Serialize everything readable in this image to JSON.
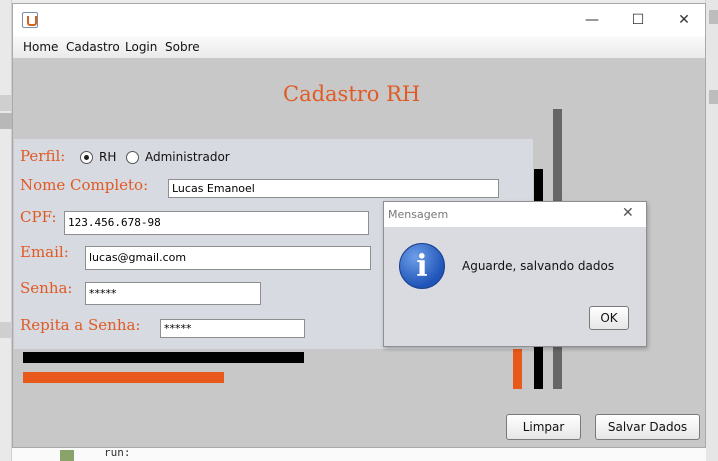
{
  "window": {
    "title": ""
  },
  "menu": {
    "items": [
      "Home",
      "Cadastro",
      "Login",
      "Sobre"
    ]
  },
  "form": {
    "heading": "Cadastro RH",
    "perfil_label": "Perfil:",
    "perfil_options": [
      {
        "label": "RH",
        "selected": true
      },
      {
        "label": "Administrador",
        "selected": false
      }
    ],
    "nome_label": "Nome Completo:",
    "nome_value": "Lucas Emanoel",
    "cpf_label": "CPF:",
    "cpf_value": "123.456.678-98",
    "email_label": "Email:",
    "email_value": "lucas@gmail.com",
    "senha_label": "Senha:",
    "senha_value": "*****",
    "repita_label": "Repita a Senha:",
    "repita_value": "*****"
  },
  "buttons": {
    "limpar": "Limpar",
    "salvar": "Salvar Dados"
  },
  "dialog": {
    "title": "Mensagem",
    "message": "Aguarde, salvando dados",
    "ok": "OK",
    "icon": "info-icon"
  },
  "background_code": "run:",
  "colors": {
    "accent": "#e05a24",
    "content_bg": "#c8c8c8",
    "panel_bg": "#d7dae1"
  }
}
